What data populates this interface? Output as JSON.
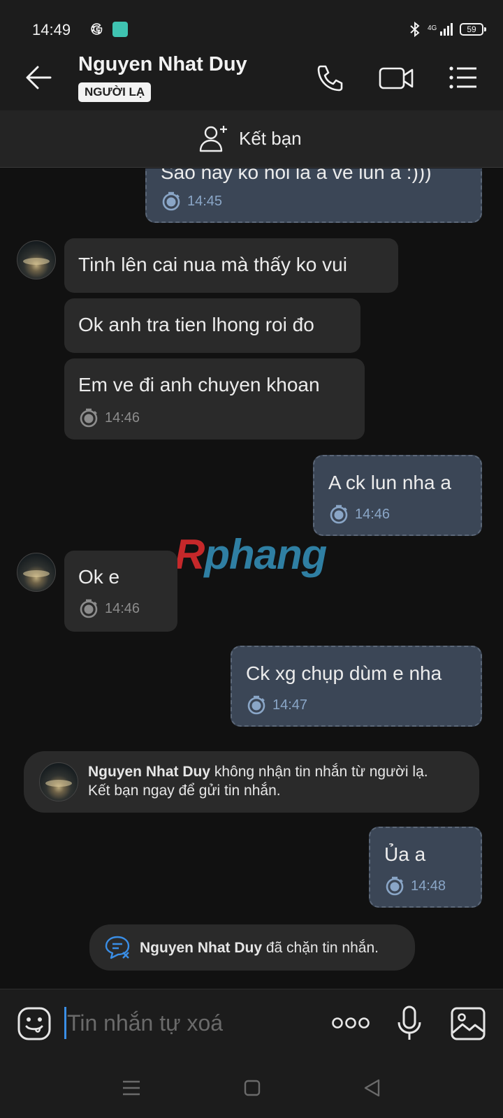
{
  "status_bar": {
    "time": "14:49",
    "network": "4G",
    "battery": "59"
  },
  "header": {
    "contact_name": "Nguyen Nhat Duy",
    "badge": "NGƯỜI LẠ"
  },
  "add_friend": {
    "label": "Kết bạn"
  },
  "messages": [
    {
      "direction": "out",
      "text": "Sao nấy ko nói là a về lun a :)))",
      "time": "14:45"
    },
    {
      "direction": "in",
      "text": "Tinh lên cai nua mà thấy ko vui",
      "time": ""
    },
    {
      "direction": "in",
      "text": "Ok anh tra tien lhong roi đo",
      "time": ""
    },
    {
      "direction": "in",
      "text": "Em ve đi anh chuyen khoan",
      "time": "14:46"
    },
    {
      "direction": "out",
      "text": "A ck lun nha a",
      "time": "14:46"
    },
    {
      "direction": "in",
      "text": "Ok e",
      "time": "14:46"
    },
    {
      "direction": "out",
      "text": "Ck xg chụp dùm e nha",
      "time": "14:47"
    },
    {
      "direction": "out",
      "text": "Ủa a",
      "time": "14:48"
    }
  ],
  "notice_stranger": {
    "name": "Nguyen Nhat Duy",
    "line1_rest": " không nhận tin nhắn từ người lạ.",
    "line2": "Kết bạn ngay để gửi tin nhắn."
  },
  "notice_blocked": {
    "name": "Nguyen Nhat Duy",
    "rest": " đã chặn tin nhắn."
  },
  "watermark": {
    "first": "R",
    "rest": "phang"
  },
  "input": {
    "placeholder": "Tin nhắn tự xoá"
  },
  "colors": {
    "background": "#111111",
    "incoming_bubble": "#2a2a2a",
    "outgoing_bubble": "#3b4656",
    "accent": "#3a8ee6"
  },
  "icons": [
    "back-arrow-icon",
    "phone-icon",
    "video-call-icon",
    "menu-list-icon",
    "add-friend-icon",
    "timer-icon",
    "emoji-icon",
    "more-icon",
    "microphone-icon",
    "gallery-icon",
    "blocked-chat-icon"
  ]
}
